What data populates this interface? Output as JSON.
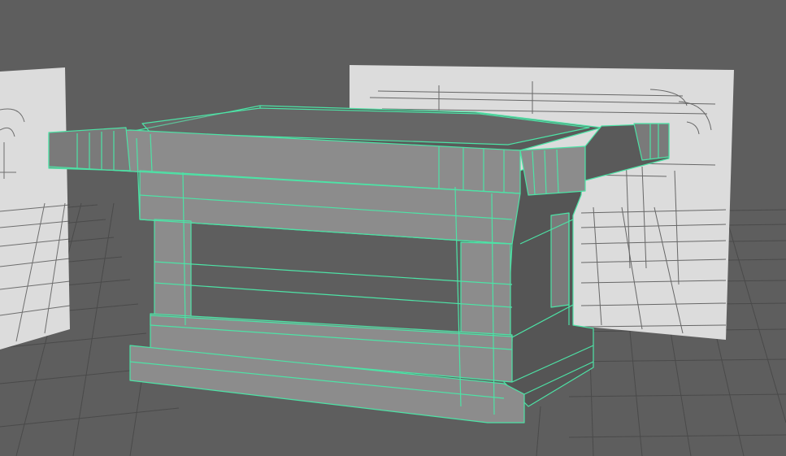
{
  "viewport": {
    "kind": "3d-perspective-viewport",
    "background_color": "#5e5e5e",
    "grid_color": "#4a4a4a",
    "reference_plane_color": "#dcdcdc",
    "sketch_line_color": "#4a4a4a",
    "model": {
      "name": "table",
      "selected": true,
      "wireframe_color": "#4de3a6",
      "face_top_color": "#5a5a5a",
      "face_light_color": "#8c8c8c",
      "face_dark_color": "#555555"
    },
    "objects": [
      "left-image-plane",
      "right-image-plane",
      "ground-grid",
      "table-model"
    ]
  }
}
